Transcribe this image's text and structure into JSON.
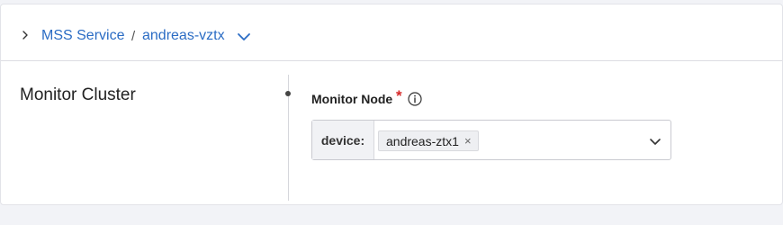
{
  "breadcrumb": {
    "items": [
      {
        "label": "MSS Service"
      },
      {
        "label": "andreas-vztx"
      }
    ],
    "separator": "/"
  },
  "section": {
    "title": "Monitor Cluster"
  },
  "form": {
    "field_label": "Monitor Node",
    "required_marker": "*",
    "select": {
      "prefix": "device:",
      "selected_tags": [
        "andreas-ztx1"
      ],
      "remove_glyph": "×"
    }
  },
  "colors": {
    "link": "#2b6cc4",
    "required": "#d62828",
    "background": "#f2f3f7"
  },
  "icons": {
    "expand": "chevron-right-icon",
    "breadcrumb_dropdown": "chevron-down-icon",
    "info": "info-icon",
    "select_dropdown": "chevron-down-icon"
  }
}
